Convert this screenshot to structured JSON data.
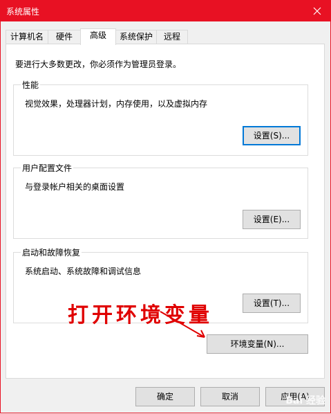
{
  "window": {
    "title": "系统属性",
    "accent": "#e81123",
    "close_icon": "close-icon"
  },
  "tabs": [
    {
      "label": "计算机名"
    },
    {
      "label": "硬件"
    },
    {
      "label": "高级",
      "active": true
    },
    {
      "label": "系统保护"
    },
    {
      "label": "远程"
    }
  ],
  "notice": "要进行大多数更改，你必须作为管理员登录。",
  "performance": {
    "label": "性能",
    "desc": "视觉效果，处理器计划，内存使用，以及虚拟内存",
    "button": "设置(S)..."
  },
  "profiles": {
    "label": "用户配置文件",
    "desc": "与登录帐户相关的桌面设置",
    "button": "设置(E)..."
  },
  "startup": {
    "label": "启动和故障恢复",
    "desc": "系统启动、系统故障和调试信息",
    "button": "设置(T)..."
  },
  "env_button": "环境变量(N)...",
  "annotation": "打开环境变量",
  "annotation_color": "#e00000",
  "footer": {
    "ok": "确定",
    "cancel": "取消",
    "apply": "应用(A)"
  },
  "watermark": "Bai 经验"
}
